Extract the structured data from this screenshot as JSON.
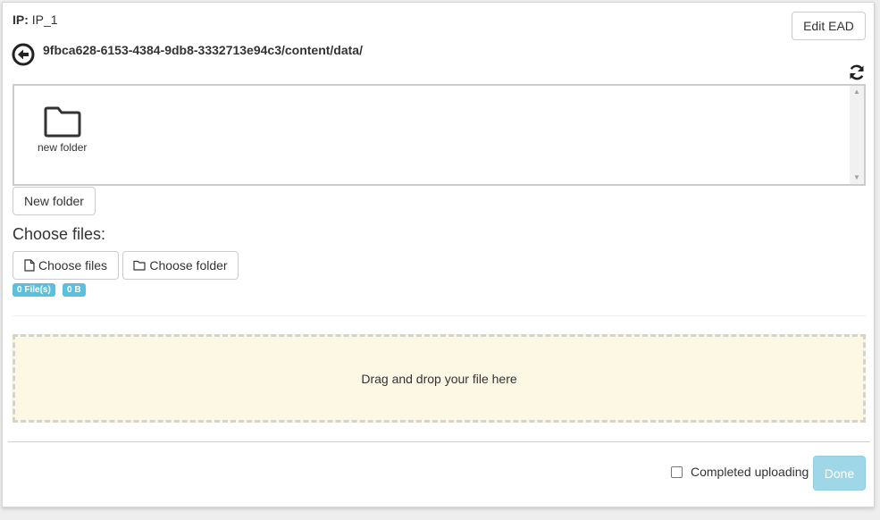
{
  "header": {
    "ip_label": "IP:",
    "ip_value": "IP_1",
    "edit_ead_label": "Edit EAD"
  },
  "browser": {
    "path": "9fbca628-6153-4384-9db8-3332713e94c3/content/data/",
    "items": [
      {
        "label": "new folder",
        "icon": "folder-icon"
      }
    ]
  },
  "actions": {
    "new_folder_label": "New folder",
    "choose_title": "Choose files:",
    "choose_files_label": "Choose files",
    "choose_folder_label": "Choose folder",
    "file_count_badge": "0 File(s)",
    "file_size_badge": "0 B"
  },
  "dropzone": {
    "text": "Drag and drop your file here"
  },
  "footer": {
    "completed_label": "Completed uploading",
    "completed_checked": false,
    "done_label": "Done"
  },
  "colors": {
    "badge": "#5bc0de",
    "dropzone_bg": "#fcf8e3",
    "done_bg": "#9fd7e9"
  }
}
